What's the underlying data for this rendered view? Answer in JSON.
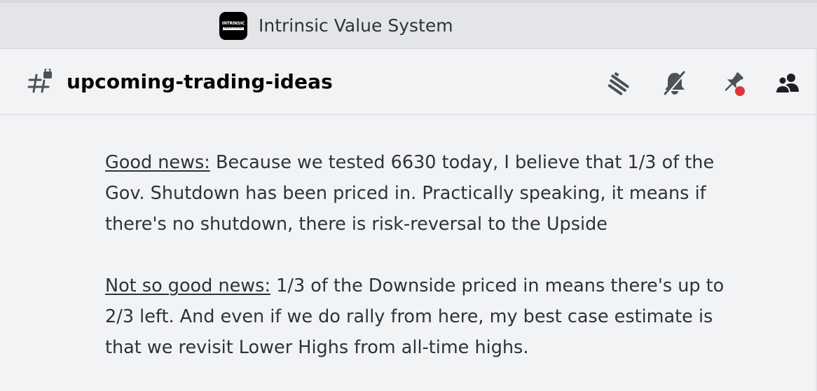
{
  "titlebar": {
    "logo_line1": "INTRINSIC",
    "logo_line2": "VALUE SYSTEM",
    "server_name": "Intrinsic Value System"
  },
  "channel": {
    "name": "upcoming-trading-ideas",
    "icon": "hash-lock-icon"
  },
  "toolbar": {
    "icons": [
      "threads-icon",
      "bell-muted-icon",
      "pin-icon",
      "members-icon"
    ],
    "pin_badge_color": "#da373c"
  },
  "message": {
    "p1_label": "Good news:",
    "p1_line1": " Because we tested 6630 today, I believe that 1/3 of the",
    "p1_line2": "Gov. Shutdown has been priced in. Practically speaking, it means if",
    "p1_line3": "there's no shutdown, there is risk-reversal to the Upside",
    "p2_label": "Not so good news:",
    "p2_line1": " 1/3 of the Downside priced in means there's up to",
    "p2_line2": "2/3 left. And even if we do rally from here, my best case estimate is",
    "p2_line3": "that we revisit Lower Highs from all-time highs."
  }
}
